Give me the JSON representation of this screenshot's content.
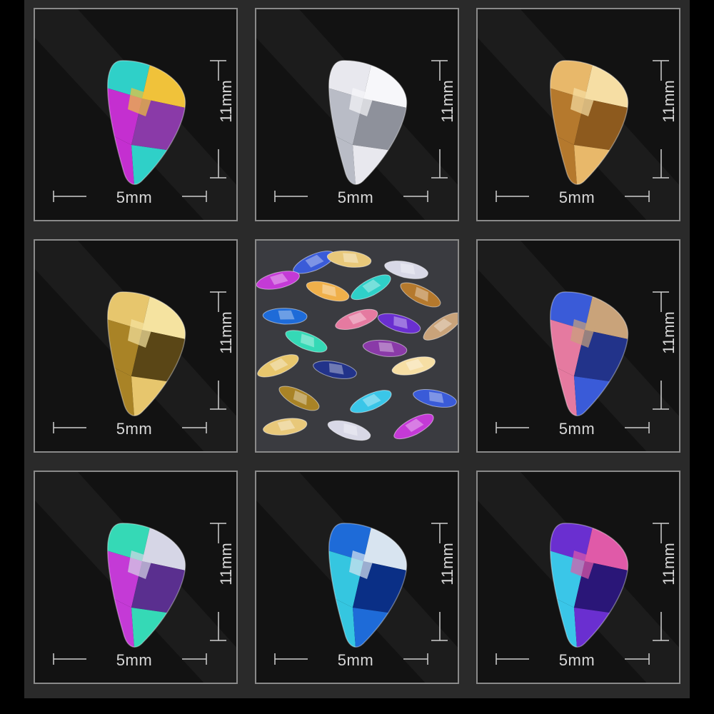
{
  "dimension_labels": {
    "width": "5mm",
    "height": "11mm"
  },
  "tiles": [
    {
      "variant": "aurora-borealis",
      "colors": [
        "#2fd0c8",
        "#c42fd0",
        "#f0c23a",
        "#8a3aa8"
      ]
    },
    {
      "variant": "clear",
      "colors": [
        "#e8e8ee",
        "#b9bcc6",
        "#f7f7fa",
        "#8e919b"
      ]
    },
    {
      "variant": "champagne",
      "colors": [
        "#e8b86a",
        "#b5792d",
        "#f6dea4",
        "#8d5a1e"
      ]
    },
    {
      "variant": "gold-back",
      "colors": [
        "#e7c66d",
        "#a98326",
        "#f5e3a0",
        "#5a4616"
      ]
    },
    {
      "variant": "photo",
      "colors": [
        "#3a3b40"
      ]
    },
    {
      "variant": "volcano",
      "colors": [
        "#3a5bd8",
        "#e57aa0",
        "#c9a37a",
        "#22338a"
      ]
    },
    {
      "variant": "paradise-shine",
      "colors": [
        "#35d9b6",
        "#c43ad6",
        "#d6d6e6",
        "#5a2f8f"
      ]
    },
    {
      "variant": "blue-ab",
      "colors": [
        "#1e6bd8",
        "#35c6e0",
        "#d8e4f0",
        "#0a2f86"
      ]
    },
    {
      "variant": "purple-velvet",
      "colors": [
        "#6a2fd0",
        "#3ac6e8",
        "#e05aa8",
        "#2a1678"
      ]
    }
  ],
  "photo_stones": [
    "#3a5bd8",
    "#e8c87a",
    "#d8d8e6",
    "#c43ad6",
    "#f0b04a",
    "#2fd0c8",
    "#b5792d",
    "#1e6bd8",
    "#e57aa0",
    "#6a2fd0",
    "#c9a37a",
    "#35d9b6",
    "#8a3aa8",
    "#e7c66d",
    "#22338a",
    "#f6dea4",
    "#a98326",
    "#3ac6e8"
  ]
}
